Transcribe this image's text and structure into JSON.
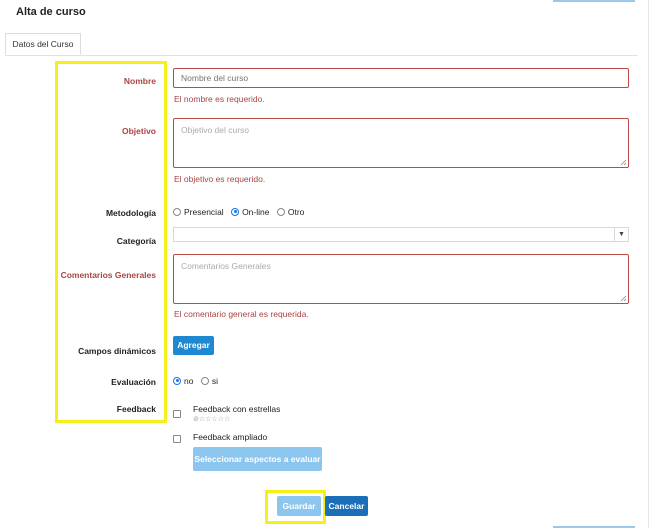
{
  "page": {
    "title": "Alta de curso"
  },
  "tabs": [
    {
      "label": "Datos del Curso",
      "active": true
    }
  ],
  "form": {
    "nombre": {
      "label": "Nombre",
      "placeholder": "Nombre del curso",
      "value": "",
      "error": "El nombre es requerido."
    },
    "objetivo": {
      "label": "Objetivo",
      "placeholder": "Objetivo del curso",
      "value": "",
      "error": "El objetivo es requerido."
    },
    "metodologia": {
      "label": "Metodología",
      "options": [
        "Presencial",
        "On-line",
        "Otro"
      ],
      "selected": "On-line"
    },
    "categoria": {
      "label": "Categoría",
      "value": ""
    },
    "comentarios": {
      "label": "Comentarios Generales",
      "placeholder": "Comentarios Generales",
      "value": "",
      "error": "El comentario general es requerida."
    },
    "campos": {
      "label": "Campos dinámicos",
      "button": "Agregar"
    },
    "evaluacion": {
      "label": "Evaluación",
      "options": [
        "no",
        "si"
      ],
      "selected": "no"
    },
    "feedback": {
      "label": "Feedback",
      "stars_option": "Feedback con estrellas",
      "stars_rating": 0,
      "stars_icon": "⊘☆☆☆☆☆",
      "extended_option": "Feedback ampliado",
      "aspects_button": "Seleccionar aspectos a evaluar"
    }
  },
  "actions": {
    "save": "Guardar",
    "cancel": "Cancelar"
  },
  "colors": {
    "primary": "#1e88d0",
    "primary_disabled": "#8cc6ef",
    "error": "#a94442",
    "highlight": "#f5ef1a"
  }
}
